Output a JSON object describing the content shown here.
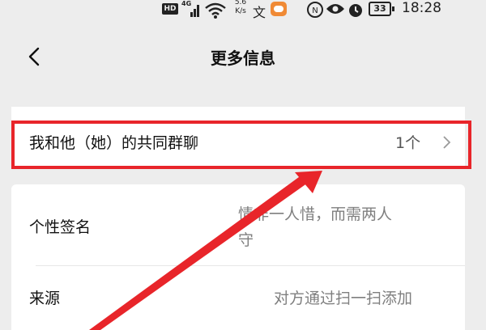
{
  "status_bar": {
    "hd_label": "HD",
    "network_type": "4G",
    "net_speed_value": "5.6",
    "net_speed_unit": "K/s",
    "wen_glyph": "文",
    "battery_level": "33",
    "time": "18:28",
    "icons": [
      "hd-icon",
      "signal-icon",
      "wifi-icon",
      "text-icon",
      "message-app-icon",
      "nfc-icon",
      "eye-icon",
      "alarm-icon",
      "battery-icon"
    ]
  },
  "nav": {
    "title": "更多信息",
    "back_icon": "chevron-left-icon"
  },
  "rows": {
    "common_groups": {
      "label": "我和他（她）的共同群聊",
      "value": "1个",
      "icon": "chevron-right-icon"
    },
    "signature": {
      "label": "个性签名",
      "value_line1": "情非一人惜，而需两人",
      "value_line2": "守"
    },
    "source": {
      "label": "来源",
      "value": "对方通过扫一扫添加"
    }
  },
  "annotation": {
    "box_color": "#e8252a",
    "arrow_color": "#e8252a"
  },
  "colors": {
    "background": "#ededed",
    "card": "#ffffff",
    "secondary_text": "#7f7f7f"
  }
}
